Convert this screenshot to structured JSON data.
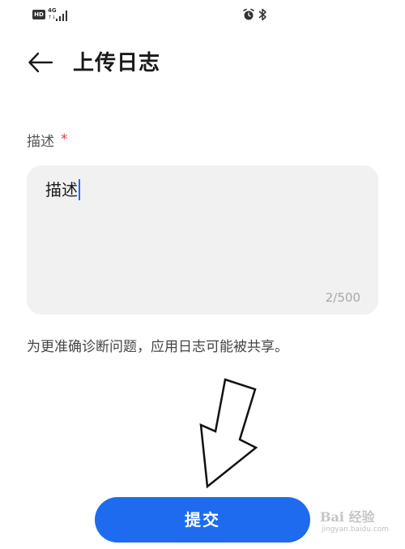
{
  "status_bar": {
    "hd_label": "HD",
    "network_label": "4G",
    "network_sub": "↑↓"
  },
  "header": {
    "title": "上传日志"
  },
  "form": {
    "field_label": "描述",
    "required_mark": "*",
    "description_value": "描述",
    "char_count": "2/500",
    "hint": "为更准确诊断问题，应用日志可能被共享。"
  },
  "actions": {
    "submit_label": "提交"
  },
  "watermark": {
    "main": "Bai 经验",
    "sub": "jingyan.baidu.com"
  },
  "colors": {
    "accent": "#1e6bf0",
    "required": "#e03a3a",
    "field_bg": "#f1f1f1"
  }
}
